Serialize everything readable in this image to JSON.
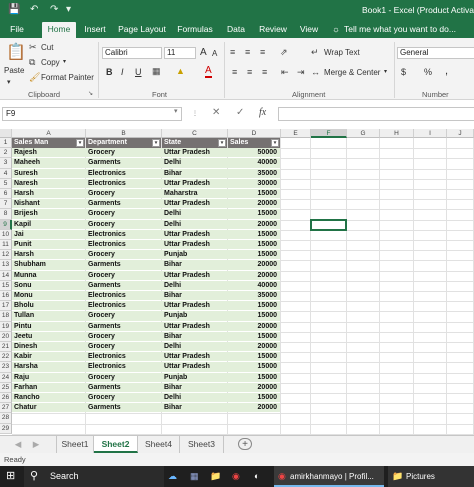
{
  "window": {
    "title": "Book1 - Excel (Product Activatio"
  },
  "quick_access": {
    "save_icon": "save-icon",
    "undo_icon": "undo-icon",
    "redo_icon": "redo-icon"
  },
  "ribbon_tabs": [
    "File",
    "Home",
    "Insert",
    "Page Layout",
    "Formulas",
    "Data",
    "Review",
    "View"
  ],
  "ribbon_active_tab": "Home",
  "tell_me": "Tell me what you want to do...",
  "ribbon": {
    "clipboard": {
      "paste": "Paste",
      "cut": "Cut",
      "copy": "Copy",
      "format_painter": "Format Painter",
      "label": "Clipboard"
    },
    "font": {
      "name": "Calibri",
      "size": "11",
      "bold": "B",
      "italic": "I",
      "underline": "U",
      "font_color_glyph": "A",
      "grow": "A",
      "shrink": "A",
      "label": "Font"
    },
    "alignment": {
      "wrap_text": "Wrap Text",
      "merge_center": "Merge & Center",
      "label": "Alignment"
    },
    "number": {
      "format": "General",
      "currency": "$",
      "percent": "%",
      "comma": ",",
      "label": "Number"
    }
  },
  "formula_bar": {
    "name_box": "F9",
    "cancel": "✕",
    "enter": "✓",
    "fx": "fx",
    "value": ""
  },
  "columns": [
    "A",
    "B",
    "C",
    "D",
    "E",
    "F",
    "G",
    "H",
    "I",
    "J"
  ],
  "selected_column": "F",
  "row_numbers": [
    "1",
    "2",
    "3",
    "4",
    "5",
    "6",
    "7",
    "8",
    "9",
    "10",
    "11",
    "12",
    "13",
    "14",
    "15",
    "16",
    "17",
    "18",
    "19",
    "20",
    "21",
    "22",
    "23",
    "24",
    "25",
    "26",
    "27",
    "28",
    "29"
  ],
  "selected_row": "9",
  "table": {
    "headers": [
      "Sales Man",
      "Department",
      "State",
      "Sales"
    ],
    "rows": [
      [
        "Rajesh",
        "Grocery",
        "Uttar Pradesh",
        "50000"
      ],
      [
        "Maheeh",
        "Garments",
        "Delhi",
        "40000"
      ],
      [
        "Suresh",
        "Electronics",
        "Bihar",
        "35000"
      ],
      [
        "Naresh",
        "Electronics",
        "Uttar Pradesh",
        "30000"
      ],
      [
        "Harsh",
        "Grocery",
        "Maharstra",
        "15000"
      ],
      [
        "Nishant",
        "Garments",
        "Uttar Pradesh",
        "20000"
      ],
      [
        "Brijesh",
        "Grocery",
        "Delhi",
        "15000"
      ],
      [
        "Kapil",
        "Grocery",
        "Delhi",
        "20000"
      ],
      [
        "Jai",
        "Electronics",
        "Uttar Pradesh",
        "15000"
      ],
      [
        "Punit",
        "Electronics",
        "Uttar Pradesh",
        "15000"
      ],
      [
        "Harsh",
        "Grocery",
        "Punjab",
        "15000"
      ],
      [
        "Shubham",
        "Garments",
        "Bihar",
        "20000"
      ],
      [
        "Munna",
        "Grocery",
        "Uttar Pradesh",
        "20000"
      ],
      [
        "Sonu",
        "Garments",
        "Delhi",
        "40000"
      ],
      [
        "Monu",
        "Electronics",
        "Bihar",
        "35000"
      ],
      [
        "Bholu",
        "Electronics",
        "Uttar Pradesh",
        "15000"
      ],
      [
        "Tullan",
        "Grocery",
        "Punjab",
        "15000"
      ],
      [
        "Pintu",
        "Garments",
        "Uttar Pradesh",
        "20000"
      ],
      [
        "Jeetu",
        "Grocery",
        "Bihar",
        "15000"
      ],
      [
        "Dinesh",
        "Grocery",
        "Delhi",
        "20000"
      ],
      [
        "Kabir",
        "Electronics",
        "Uttar Pradesh",
        "15000"
      ],
      [
        "Harsha",
        "Electronics",
        "Uttar Pradesh",
        "15000"
      ],
      [
        "Raju",
        "Grocery",
        "Punjab",
        "15000"
      ],
      [
        "Farhan",
        "Garments",
        "Bihar",
        "20000"
      ],
      [
        "Rancho",
        "Grocery",
        "Delhi",
        "15000"
      ],
      [
        "Chatur",
        "Garments",
        "Bihar",
        "20000"
      ]
    ]
  },
  "sheets": [
    "Sheet1",
    "Sheet2",
    "Sheet4",
    "Sheet3"
  ],
  "active_sheet": "Sheet2",
  "add_sheet": "+",
  "status": "Ready",
  "taskbar": {
    "search": "Search",
    "profile_item": "amirkhanmayo | Profil...",
    "pictures": "Pictures"
  },
  "colors": {
    "excel_green": "#217346",
    "table_band": "#e2efda",
    "table_header": "#757171"
  }
}
